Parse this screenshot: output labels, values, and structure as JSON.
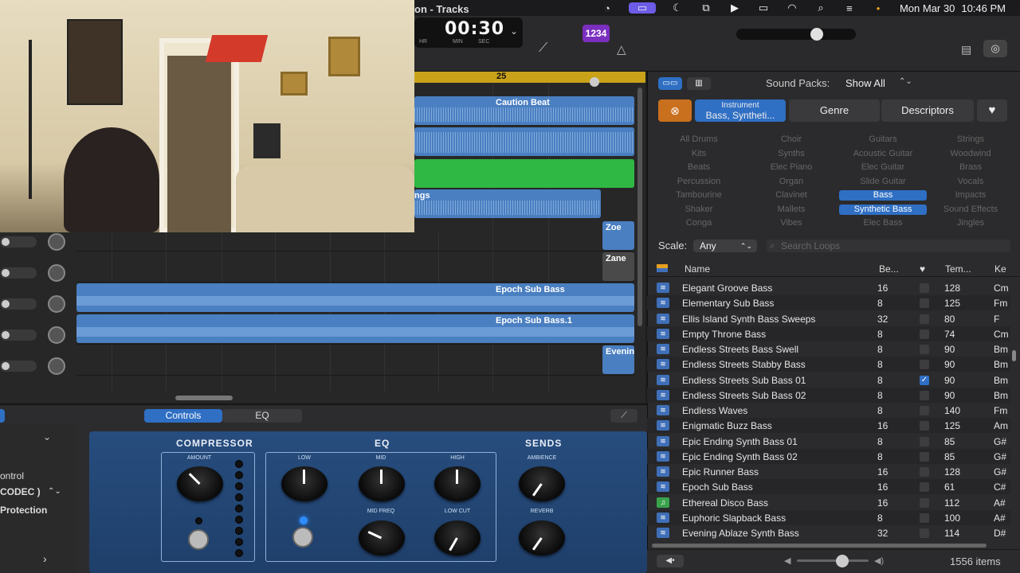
{
  "menubar": {
    "date": "Mon Mar 30",
    "time": "10:46 PM",
    "icons": [
      "backup-icon",
      "screen-mirror-icon",
      "moon-icon",
      "window-icon",
      "play-circle-icon",
      "battery-icon",
      "wifi-icon",
      "search-icon",
      "control-center-icon",
      "siri-dot-icon"
    ]
  },
  "toolbar": {
    "title": "on - Tracks",
    "lcd_time": "00:30",
    "lcd_hr": "HR",
    "lcd_min": "MIN",
    "lcd_sec": "SEC",
    "count_in": "1234"
  },
  "tracks": {
    "ruler_bar": "25",
    "regions": {
      "caution": "Caution Beat",
      "strings": "ngs",
      "zoe": "Zoe",
      "zane": "Zane",
      "epoch": "Epoch Sub Bass",
      "epoch1": "Epoch Sub Bass.1",
      "evening": "Evenin"
    }
  },
  "smart_controls": {
    "tab_controls": "Controls",
    "tab_eq": "EQ",
    "left": {
      "control": "ontrol",
      "codec": "CODEC )",
      "protection": "Protection"
    },
    "sections": {
      "compressor": "COMPRESSOR",
      "eq": "EQ",
      "sends": "SENDS"
    },
    "knobs": {
      "amount": "AMOUNT",
      "low": "LOW",
      "mid": "MID",
      "high": "HIGH",
      "mid_freq": "MID FREQ",
      "low_cut": "LOW CUT",
      "ambience": "AMBIENCE",
      "reverb": "REVERB"
    }
  },
  "browser": {
    "sound_packs_label": "Sound Packs:",
    "sound_packs_value": "Show All",
    "filter_tabs": {
      "instrument_small": "Instrument",
      "instrument_big": "Bass, Syntheti...",
      "genre": "Genre",
      "descriptors": "Descriptors"
    },
    "keywords": [
      [
        "All Drums",
        "Choir",
        "Guitars",
        "Strings"
      ],
      [
        "Kits",
        "Synths",
        "Acoustic Guitar",
        "Woodwind"
      ],
      [
        "Beats",
        "Elec Piano",
        "Elec Guitar",
        "Brass"
      ],
      [
        "Percussion",
        "Organ",
        "Slide Guitar",
        "Vocals"
      ],
      [
        "Tambourine",
        "Clavinet",
        "Bass",
        "Impacts"
      ],
      [
        "Shaker",
        "Mallets",
        "Synthetic Bass",
        "Sound Effects"
      ],
      [
        "Conga",
        "Vibes",
        "Elec Bass",
        "Jingles"
      ]
    ],
    "keyword_selected": [
      "Bass",
      "Synthetic Bass"
    ],
    "scale_label": "Scale:",
    "scale_value": "Any",
    "search_placeholder": "Search Loops",
    "columns": {
      "name": "Name",
      "beats": "Be...",
      "tempo": "Tem...",
      "key": "Ke"
    },
    "rows": [
      {
        "name": "Elegant Groove Bass",
        "beats": "16",
        "tempo": "128",
        "key": "Cm",
        "fav": false,
        "type": "audio"
      },
      {
        "name": "Elementary Sub Bass",
        "beats": "8",
        "tempo": "125",
        "key": "Fm",
        "fav": false,
        "type": "audio"
      },
      {
        "name": "Ellis Island Synth Bass Sweeps",
        "beats": "32",
        "tempo": "80",
        "key": "F",
        "fav": false,
        "type": "audio"
      },
      {
        "name": "Empty Throne Bass",
        "beats": "8",
        "tempo": "74",
        "key": "Cm",
        "fav": false,
        "type": "audio"
      },
      {
        "name": "Endless Streets Bass Swell",
        "beats": "8",
        "tempo": "90",
        "key": "Bm",
        "fav": false,
        "type": "audio"
      },
      {
        "name": "Endless Streets Stabby Bass",
        "beats": "8",
        "tempo": "90",
        "key": "Bm",
        "fav": false,
        "type": "audio"
      },
      {
        "name": "Endless Streets Sub Bass 01",
        "beats": "8",
        "tempo": "90",
        "key": "Bm",
        "fav": true,
        "type": "audio"
      },
      {
        "name": "Endless Streets Sub Bass 02",
        "beats": "8",
        "tempo": "90",
        "key": "Bm",
        "fav": false,
        "type": "audio"
      },
      {
        "name": "Endless Waves",
        "beats": "8",
        "tempo": "140",
        "key": "Fm",
        "fav": false,
        "type": "audio"
      },
      {
        "name": "Enigmatic Buzz Bass",
        "beats": "16",
        "tempo": "125",
        "key": "Am",
        "fav": false,
        "type": "audio"
      },
      {
        "name": "Epic Ending Synth Bass 01",
        "beats": "8",
        "tempo": "85",
        "key": "G#",
        "fav": false,
        "type": "audio"
      },
      {
        "name": "Epic Ending Synth Bass 02",
        "beats": "8",
        "tempo": "85",
        "key": "G#",
        "fav": false,
        "type": "audio"
      },
      {
        "name": "Epic Runner Bass",
        "beats": "16",
        "tempo": "128",
        "key": "G#",
        "fav": false,
        "type": "audio"
      },
      {
        "name": "Epoch Sub Bass",
        "beats": "16",
        "tempo": "61",
        "key": "C#",
        "fav": false,
        "type": "audio"
      },
      {
        "name": "Ethereal Disco Bass",
        "beats": "16",
        "tempo": "112",
        "key": "A#",
        "fav": false,
        "type": "midi"
      },
      {
        "name": "Euphoric Slapback Bass",
        "beats": "8",
        "tempo": "100",
        "key": "A#",
        "fav": false,
        "type": "audio"
      },
      {
        "name": "Evening Ablaze Synth Bass",
        "beats": "32",
        "tempo": "114",
        "key": "D#",
        "fav": false,
        "type": "audio"
      }
    ],
    "item_count": "1556 items"
  }
}
